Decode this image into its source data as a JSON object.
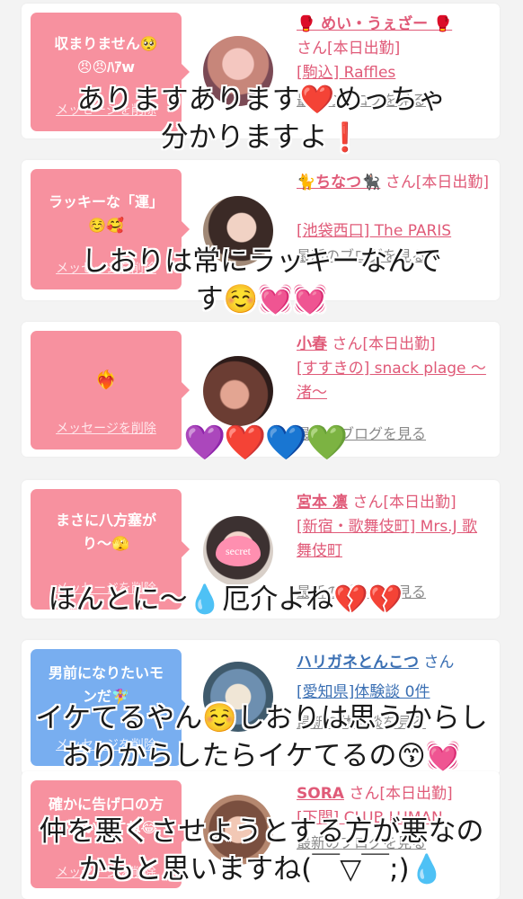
{
  "cards": [
    {
      "bubble_message": "収まりません🥺\n😠😠ﾊｱw",
      "bubble_delete": "メッセージを削除",
      "name": "🥊 めい・うぇざー 🥊",
      "status": "さん[本日出勤]",
      "shop": "[駒込] Raffles",
      "blog": "最新のブログを見る"
    },
    {
      "bubble_message": "ラッキーな「運」\n☺️🥰",
      "bubble_delete": "メッセージを削除",
      "name": "🐈ちなつ🐈‍⬛",
      "status": "さん[本日出勤]",
      "shop": "[池袋西口] The PARIS",
      "blog": "最新のブログを見る"
    },
    {
      "bubble_message": "❤️‍🔥",
      "bubble_delete": "メッセージを削除",
      "name": "小春",
      "status": "さん[本日出勤]",
      "shop": "[すすきの] snack plage ～渚～",
      "blog": "最新のブログを見る"
    },
    {
      "bubble_message": "まさに八方塞が\nり〜🫣",
      "bubble_delete": "メッセージを削除",
      "name": "宮本 凛",
      "status": "さん[本日出勤]",
      "shop": "[新宿・歌舞伎町] Mrs.J 歌舞伎町",
      "blog": "最新のブログを見る",
      "avatar_label": "secret"
    },
    {
      "bubble_message": "男前になりたいモ\nンだ🧚‍♀️",
      "bubble_delete": "メッセージを削除",
      "name": "ハリガネとんこつ",
      "status": "さん",
      "shop": "[愛知県]体験談 0件",
      "blog": "最新の体験談を見る"
    },
    {
      "bubble_message": "確かに告げ口の方\nが悪いですね😂",
      "bubble_delete": "メッセージを削除",
      "name": "SORA",
      "status": "さん[本日出勤]",
      "shop": "[下関] CLUB LUMAN",
      "blog": "最新のブログを見る"
    }
  ],
  "overlays": [
    "ありますあります❤️めっちゃ\n分かりますよ❗️",
    "しおりは常にラッキーなんで\nす☺️💓💓",
    "💜❤️💙💚",
    "ほんとに〜💧厄介よね💔💔",
    "イケてるやん☺️しおりは思うからし\nおりからしたらイケてるの😙💓",
    "仲を悪くさせようとする方が悪なの\nかもと思いますね(￣▽￣;)💧"
  ],
  "colors": {
    "bubble_pink": "#f7919f",
    "bubble_blue": "#78aef0",
    "name_pink": "#e05a78",
    "name_blue": "#3a6fb3",
    "background": "#f3f3f3"
  }
}
